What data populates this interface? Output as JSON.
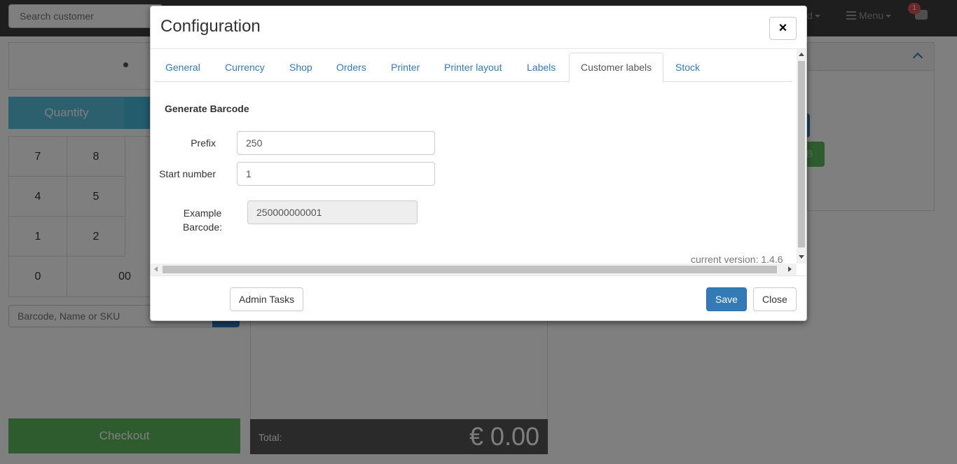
{
  "app": {
    "search_placeholder": "Search customer",
    "nav_partial": "d",
    "menu_label": "Menu",
    "notification_count": "1",
    "quantity_label": "Quantity",
    "keypad": [
      "7",
      "8",
      "4",
      "5",
      "1",
      "2",
      "0",
      "00"
    ],
    "barcode_placeholder": "Barcode, Name or SKU",
    "checkout_label": "Checkout",
    "total_label": "Total:",
    "total_value": "€ 0.00",
    "right_partial": "B"
  },
  "modal": {
    "title": "Configuration",
    "close_icon": "×",
    "tabs": [
      {
        "label": "General",
        "active": false
      },
      {
        "label": "Currency",
        "active": false
      },
      {
        "label": "Shop",
        "active": false
      },
      {
        "label": "Orders",
        "active": false
      },
      {
        "label": "Printer",
        "active": false
      },
      {
        "label": "Printer layout",
        "active": false
      },
      {
        "label": "Labels",
        "active": false
      },
      {
        "label": "Customer labels",
        "active": true
      },
      {
        "label": "Stock",
        "active": false
      }
    ],
    "section_title": "Generate Barcode",
    "fields": {
      "prefix_label": "Prefix",
      "prefix_value": "250",
      "start_label": "Start number",
      "start_value": "1",
      "example_label_1": "Example",
      "example_label_2": "Barcode:",
      "example_value": "250000000001"
    },
    "version": "current version: 1.4.6",
    "footer": {
      "admin_label": "Admin Tasks",
      "save_label": "Save",
      "close_label": "Close"
    }
  },
  "colors": {
    "primary": "#337ab7",
    "success": "#5cb85c",
    "info": "#5bc0de",
    "danger": "#d9534f"
  }
}
